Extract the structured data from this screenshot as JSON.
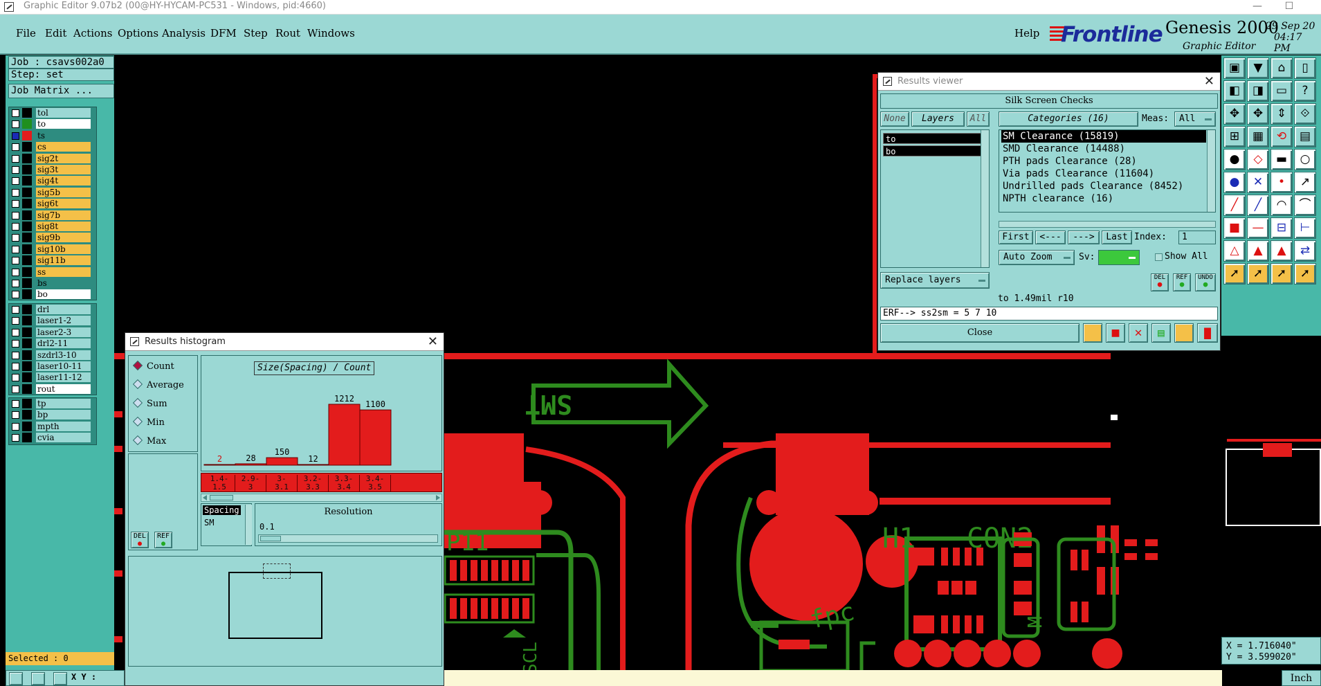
{
  "window": {
    "title": "Graphic Editor 9.07b2 (00@HY-HYCAM-PC531 - Windows, pid:4660)",
    "minimize": "—",
    "maximize": "☐"
  },
  "menu": {
    "items": [
      "File",
      "Edit",
      "Actions",
      "Options",
      "Analysis",
      "DFM",
      "Step",
      "Rout",
      "Windows"
    ],
    "help": "Help"
  },
  "logo": {
    "brand": "Frontline",
    "product": "Genesis 2000",
    "subtitle": "Graphic Editor",
    "date": "29 Sep 20",
    "time": "04:17 PM"
  },
  "job": {
    "job_label": "Job : csavs002a0",
    "step_label": "Step: set",
    "matrix_button": "Job Matrix ..."
  },
  "layers_group1": [
    {
      "name": "tol",
      "color": "#9bd8d4",
      "swatch": "#000000",
      "checked": false
    },
    {
      "name": "to",
      "color": "#ffffff",
      "swatch": "#1f8f1f",
      "checked": false
    },
    {
      "name": "ts",
      "color": "#2e8c80",
      "swatch": "#e31c1c",
      "checked": true
    },
    {
      "name": "cs",
      "color": "#f4c048",
      "swatch": "#000000",
      "checked": false
    },
    {
      "name": "sig2t",
      "color": "#f4c048",
      "swatch": "#000000",
      "checked": false
    },
    {
      "name": "sig3t",
      "color": "#f4c048",
      "swatch": "#000000",
      "checked": false
    },
    {
      "name": "sig4t",
      "color": "#f4c048",
      "swatch": "#000000",
      "checked": false
    },
    {
      "name": "sig5b",
      "color": "#f4c048",
      "swatch": "#000000",
      "checked": false
    },
    {
      "name": "sig6t",
      "color": "#f4c048",
      "swatch": "#000000",
      "checked": false
    },
    {
      "name": "sig7b",
      "color": "#f4c048",
      "swatch": "#000000",
      "checked": false
    },
    {
      "name": "sig8t",
      "color": "#f4c048",
      "swatch": "#000000",
      "checked": false
    },
    {
      "name": "sig9b",
      "color": "#f4c048",
      "swatch": "#000000",
      "checked": false
    },
    {
      "name": "sig10b",
      "color": "#f4c048",
      "swatch": "#000000",
      "checked": false
    },
    {
      "name": "sig11b",
      "color": "#f4c048",
      "swatch": "#000000",
      "checked": false
    },
    {
      "name": "ss",
      "color": "#f4c048",
      "swatch": "#000000",
      "checked": false
    },
    {
      "name": "bs",
      "color": "#2e8c80",
      "swatch": "#000000",
      "checked": false
    },
    {
      "name": "bo",
      "color": "#ffffff",
      "swatch": "#000000",
      "checked": false
    }
  ],
  "layers_group2": [
    {
      "name": "drl",
      "color": "#9bd8d4",
      "swatch": "#000000",
      "checked": false
    },
    {
      "name": "laser1-2",
      "color": "#9bd8d4",
      "swatch": "#000000",
      "checked": false
    },
    {
      "name": "laser2-3",
      "color": "#9bd8d4",
      "swatch": "#000000",
      "checked": false
    },
    {
      "name": "drl2-11",
      "color": "#9bd8d4",
      "swatch": "#000000",
      "checked": false
    },
    {
      "name": "szdrl3-10",
      "color": "#9bd8d4",
      "swatch": "#000000",
      "checked": false
    },
    {
      "name": "laser10-11",
      "color": "#9bd8d4",
      "swatch": "#000000",
      "checked": false
    },
    {
      "name": "laser11-12",
      "color": "#9bd8d4",
      "swatch": "#000000",
      "checked": false
    },
    {
      "name": "rout",
      "color": "#ffffff",
      "swatch": "#000000",
      "checked": false
    }
  ],
  "layers_group3": [
    {
      "name": "tp",
      "color": "#9bd8d4",
      "swatch": "#000000",
      "checked": false
    },
    {
      "name": "bp",
      "color": "#9bd8d4",
      "swatch": "#000000",
      "checked": false
    },
    {
      "name": "mpth",
      "color": "#9bd8d4",
      "swatch": "#000000",
      "checked": false
    },
    {
      "name": "cvia",
      "color": "#9bd8d4",
      "swatch": "#000000",
      "checked": false
    }
  ],
  "selected": "Selected : 0",
  "histogram": {
    "title": "Results histogram",
    "close": "✕",
    "modes": [
      {
        "label": "Count",
        "selected": true
      },
      {
        "label": "Average",
        "selected": false
      },
      {
        "label": "Sum",
        "selected": false
      },
      {
        "label": "Min",
        "selected": false
      },
      {
        "label": "Max",
        "selected": false
      }
    ],
    "chart_title": "Size(Spacing) / Count",
    "del_label": "DEL",
    "ref_label": "REF",
    "spacing_label": "Spacing",
    "sm_label": "SM",
    "resolution_label": "Resolution",
    "resolution_value": "0.1"
  },
  "chart_data": {
    "type": "bar",
    "title": "Size(Spacing) / Count",
    "categories": [
      "1.4-1.5",
      "2.9-3",
      "3-3.1",
      "3.2-3.3",
      "3.3-3.4",
      "3.4-3.5"
    ],
    "category_labels": [
      [
        "1.4-",
        "1.5"
      ],
      [
        "2.9-",
        "3"
      ],
      [
        "3-",
        "3.1"
      ],
      [
        "3.2-",
        "3.3"
      ],
      [
        "3.3-",
        "3.4"
      ],
      [
        "3.4-",
        "3.5"
      ]
    ],
    "values": [
      2,
      28,
      150,
      12,
      1212,
      1100
    ],
    "ylim": [
      0,
      1212
    ],
    "bar_color": "#e31c1c",
    "label_color_first": "#d01010"
  },
  "results": {
    "title": "Results viewer",
    "close": "✕",
    "header": "Silk Screen Checks",
    "none_btn": "None",
    "layers_btn": "Layers",
    "all_btn": "All",
    "categories_btn": "Categories (16)",
    "meas_label": "Meas:",
    "meas_value": "All",
    "layer_items": [
      "to",
      "bo"
    ],
    "categories": [
      "SM Clearance (15819)",
      "SMD Clearance (14488)",
      "PTH pads Clearance (28)",
      "Via pads Clearance (11604)",
      "Undrilled pads Clearance (8452)",
      "NPTH clearance (16)"
    ],
    "first_btn": "First",
    "prev_btn": "<---",
    "next_btn": "--->",
    "last_btn": "Last",
    "index_label": "Index:",
    "index_value": "1",
    "autozoom": "Auto Zoom",
    "sv_label": "Sv:",
    "show_all": "Show All",
    "replace_layers": "Replace layers",
    "status_line": "to 1.49mil  r10",
    "erf_line": "ERF--> ss2sm = 5 7 10",
    "close_btn": "Close"
  },
  "pcb": {
    "silk_arrow_text": "SMT",
    "label_h1": "H1",
    "label_con2": "CON2",
    "label_fpc": "fpc",
    "label_p11": "P11",
    "label_scl": "SCL",
    "label_m": "M"
  },
  "coords": {
    "x": "X = 1.716040\"",
    "y": "Y = 3.599020\""
  },
  "units": "Inch",
  "xy_label": "X Y :"
}
